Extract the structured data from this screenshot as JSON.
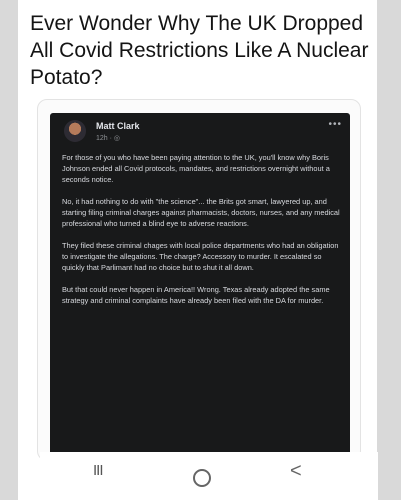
{
  "article": {
    "headline": "Ever Wonder Why The UK Dropped All Covid Restrictions Like A Nuclear Potato?"
  },
  "post": {
    "author": "Matt Clark",
    "time": "12h · ◎",
    "more": "•••",
    "paragraphs": [
      "For those of you who have been paying attention to the UK, you'll know why Boris Johnson ended all Covid protocols, mandates, and restrictions overnight without a seconds notice.",
      "No, it had nothing to do with \"the science\"... the Brits got smart, lawyered up, and starting filing criminal charges against pharmacists, doctors, nurses, and any medical professional who turned a blind eye to adverse reactions.",
      "They filed these criminal chages with local police departments who had an obligation to investigate the allegations. The charge? Accessory to murder. It escalated so quickly that Parlimant had no choice but to shut it all down.",
      "But that could never happen in America!! Wrong. Texas already adopted the same strategy and criminal complaints have already been filed with the DA for murder."
    ]
  },
  "navbar": {
    "recents": "III",
    "back": "<"
  }
}
